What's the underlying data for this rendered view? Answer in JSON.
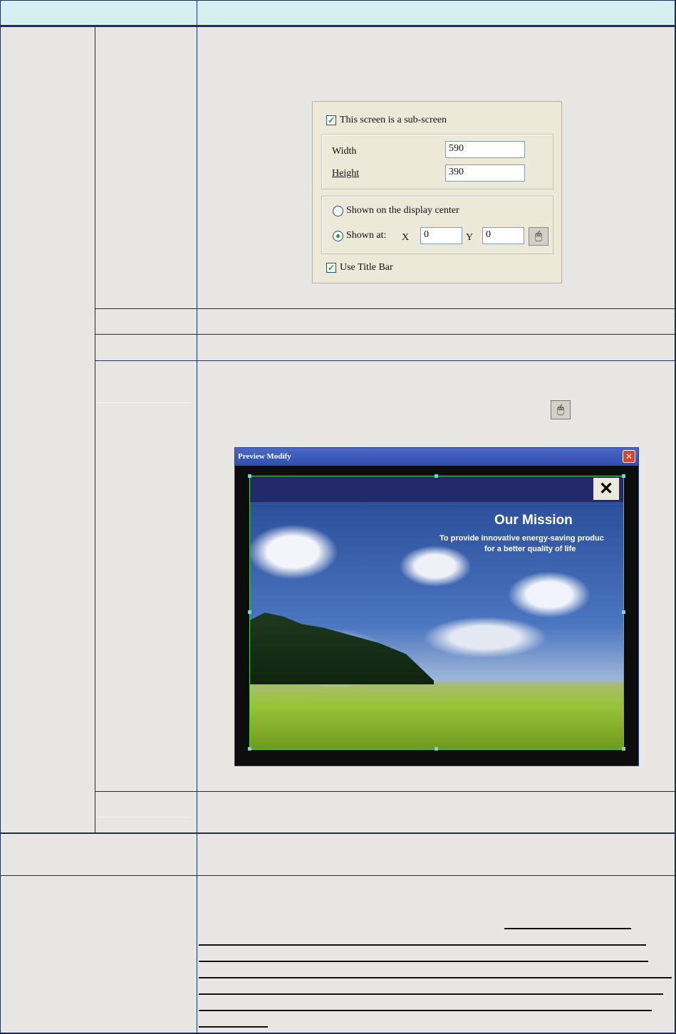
{
  "dialog": {
    "sub_screen_checkbox": "This screen is a sub-screen",
    "sub_screen_checked": true,
    "width_label": "Width",
    "width_value": "590",
    "height_label": "Height",
    "height_value": "390",
    "radio_center": "Shown on the display center",
    "radio_at": "Shown at:",
    "selected_radio": "Shown at:",
    "x_label": "X",
    "x_value": "0",
    "y_label": "Y",
    "y_value": "0",
    "title_bar_checkbox": "Use Title Bar",
    "title_bar_checked": true
  },
  "preview": {
    "title": "Preview Modify",
    "heading": "Our Mission",
    "line1": "To provide innovative energy-saving produc",
    "line2": "for a better quality of life",
    "close_glyph": "✕",
    "titlebar_close_glyph": "✕"
  },
  "colors": {
    "border": "#1f2d5a",
    "header_bg": "#d5eff0",
    "cell_bg": "#e8e6e3"
  }
}
